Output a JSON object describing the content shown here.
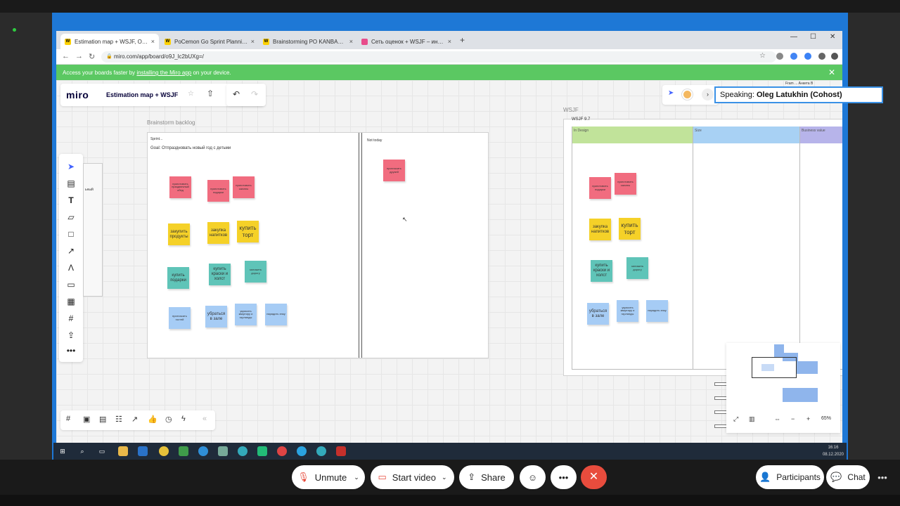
{
  "browser": {
    "tabs": [
      {
        "label": "Estimation map + WSJF, Online W",
        "icon": "miro-favicon"
      },
      {
        "label": "PoCemon Go Sprint Planning, Or",
        "icon": "miro-favicon"
      },
      {
        "label": "Brainstorming PO KANBAN Item",
        "icon": "miro-favicon"
      },
      {
        "label": "Сеть оценок + WSJF – инструм",
        "icon": "pink-favicon"
      }
    ],
    "url": "miro.com/app/board/o9J_lc2bUXg=/",
    "banner_text_pre": "Access your boards faster by ",
    "banner_link": "installing the Miro app",
    "banner_text_post": " on your device."
  },
  "miro": {
    "logo": "miro",
    "board_title": "Estimation map + WSJF",
    "speaking_label": "Speaking:",
    "speaking_name": "Oleg Latukhin (Cohost)",
    "zoom_level": "65%"
  },
  "frames": {
    "brainstorm_title": "Brainstorm backlog",
    "sprint_label": "Sprint...",
    "sprint_goal": "Goal: Отпраздновать новый год с детьми",
    "not_today": "Not today",
    "wsjf_title": "WSJF",
    "wsjf_sub": "WSJF 9.7",
    "col1": "In Design",
    "col2": "Size",
    "col3": "Business value",
    "top_right_cut": "Fram ... Анкета В"
  },
  "ghost": {
    "line1": "ьный"
  },
  "notes_left": [
    {
      "text": "приготовить праздничный обед",
      "color": "pink",
      "size": "tiny"
    },
    {
      "text": "приготовить подарки",
      "color": "pink",
      "size": "tiny"
    },
    {
      "text": "приготовить салаты",
      "color": "pink",
      "size": "tiny"
    },
    {
      "text": "закупить продукты",
      "color": "yel",
      "size": "sm"
    },
    {
      "text": "закупка напитков",
      "color": "yel",
      "size": "sm"
    },
    {
      "text": "купить торт",
      "color": "yel",
      "size": "lg"
    },
    {
      "text": "купить подарки",
      "color": "teal",
      "size": "sm"
    },
    {
      "text": "купить краски и холст",
      "color": "teal",
      "size": "sm"
    },
    {
      "text": "заложить дорогу",
      "color": "teal",
      "size": "tiny"
    },
    {
      "text": "пригласить гостей",
      "color": "blue",
      "size": "tiny"
    },
    {
      "text": "убраться в зале",
      "color": "blue",
      "size": "sm"
    },
    {
      "text": "украсить квартиру и гирлянды",
      "color": "blue",
      "size": "tiny"
    },
    {
      "text": "нарядить елку",
      "color": "blue",
      "size": "tiny"
    },
    {
      "text": "пригласить друзей",
      "color": "pink",
      "size": "tiny"
    }
  ],
  "notes_right": [
    {
      "text": "приготовить подарки",
      "color": "pink",
      "size": "tiny"
    },
    {
      "text": "приготовить салаты",
      "color": "pink",
      "size": "tiny"
    },
    {
      "text": "закупка напитков",
      "color": "yel",
      "size": "sm"
    },
    {
      "text": "купить торт",
      "color": "yel",
      "size": "lg"
    },
    {
      "text": "купить краски и холст",
      "color": "teal",
      "size": "sm"
    },
    {
      "text": "заложить дорогу",
      "color": "teal",
      "size": "tiny"
    },
    {
      "text": "убраться в зале",
      "color": "blue",
      "size": "sm"
    },
    {
      "text": "украсить квартиру и гирлянды",
      "color": "blue",
      "size": "tiny"
    },
    {
      "text": "нарядить елку",
      "color": "blue",
      "size": "tiny"
    }
  ],
  "taskbar": {
    "time": "16:16",
    "date": "08.12.2020"
  },
  "zoom_controls": {
    "unmute": "Unmute",
    "start_video": "Start video",
    "share": "Share",
    "participants": "Participants",
    "chat": "Chat"
  },
  "colors": {
    "accent": "#4262ff",
    "banner": "#5bc862",
    "end_call": "#e84c3d"
  }
}
